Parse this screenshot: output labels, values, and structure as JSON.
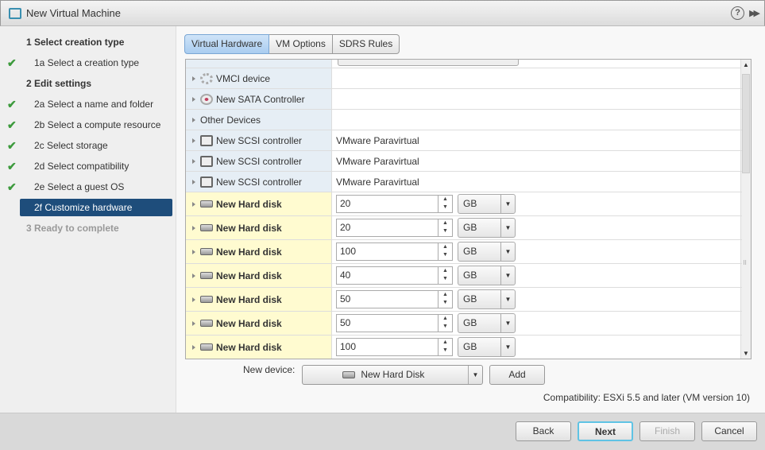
{
  "window": {
    "title": "New Virtual Machine"
  },
  "steps": [
    {
      "label": "1  Select creation type",
      "type": "header",
      "done": false
    },
    {
      "label": "1a  Select a creation type",
      "type": "sub",
      "done": true
    },
    {
      "label": "2  Edit settings",
      "type": "header",
      "done": false
    },
    {
      "label": "2a  Select a name and folder",
      "type": "sub",
      "done": true
    },
    {
      "label": "2b  Select a compute resource",
      "type": "sub",
      "done": true
    },
    {
      "label": "2c  Select storage",
      "type": "sub",
      "done": true
    },
    {
      "label": "2d  Select compatibility",
      "type": "sub",
      "done": true
    },
    {
      "label": "2e  Select a guest OS",
      "type": "sub",
      "done": true
    },
    {
      "label": "2f  Customize hardware",
      "type": "active",
      "done": false
    },
    {
      "label": "3  Ready to complete",
      "type": "disabled",
      "done": false
    }
  ],
  "tabs": [
    "Virtual Hardware",
    "VM Options",
    "SDRS Rules"
  ],
  "devices": [
    {
      "name": "VMCI device",
      "icon": "gear-icon",
      "value": ""
    },
    {
      "name": "New SATA Controller",
      "icon": "sata-icon",
      "value": ""
    },
    {
      "name": "Other Devices",
      "icon": "",
      "value": ""
    },
    {
      "name": "New SCSI controller",
      "icon": "scsi-icon",
      "value": "VMware Paravirtual"
    },
    {
      "name": "New SCSI controller",
      "icon": "scsi-icon",
      "value": "VMware Paravirtual"
    },
    {
      "name": "New SCSI controller",
      "icon": "scsi-icon",
      "value": "VMware Paravirtual"
    }
  ],
  "disks": [
    {
      "name": "New Hard disk",
      "size": "20",
      "unit": "GB"
    },
    {
      "name": "New Hard disk",
      "size": "20",
      "unit": "GB"
    },
    {
      "name": "New Hard disk",
      "size": "100",
      "unit": "GB"
    },
    {
      "name": "New Hard disk",
      "size": "40",
      "unit": "GB"
    },
    {
      "name": "New Hard disk",
      "size": "50",
      "unit": "GB"
    },
    {
      "name": "New Hard disk",
      "size": "50",
      "unit": "GB"
    },
    {
      "name": "New Hard disk",
      "size": "100",
      "unit": "GB"
    }
  ],
  "new_device": {
    "label": "New device:",
    "value": "New Hard Disk",
    "add": "Add"
  },
  "compatibility": "Compatibility: ESXi 5.5 and later (VM version 10)",
  "footer": {
    "back": "Back",
    "next": "Next",
    "finish": "Finish",
    "cancel": "Cancel"
  }
}
